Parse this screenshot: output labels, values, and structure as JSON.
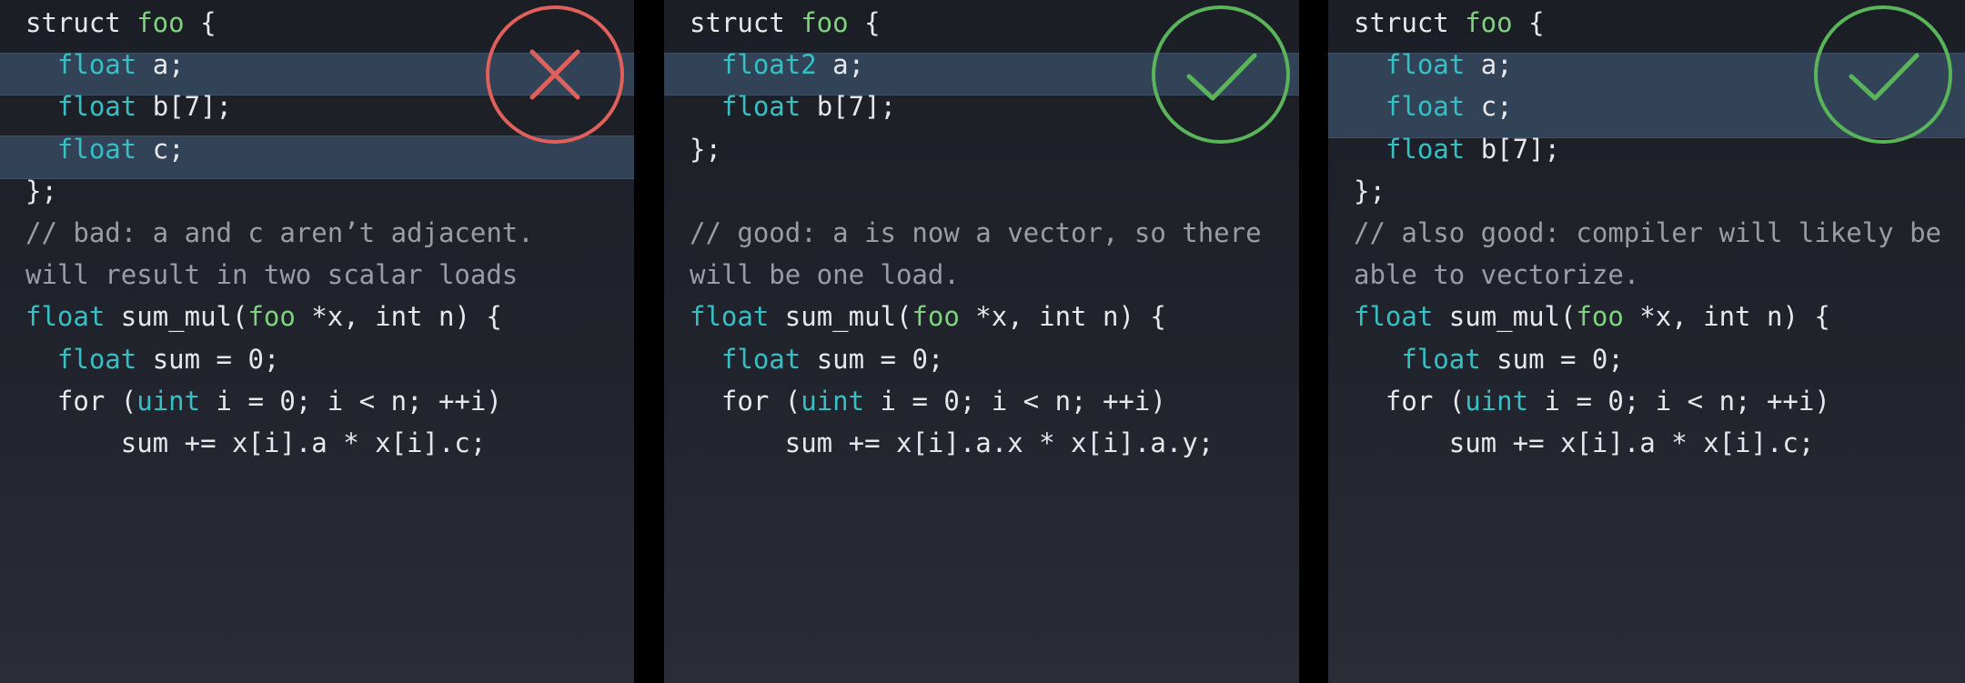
{
  "colors": {
    "background": "#000000",
    "panel_bg": "#22242d",
    "highlight_bg": "#324358",
    "keyword_type": "#34c0c4",
    "struct_name": "#7fd37f",
    "plain_text": "#e8e8ec",
    "comment": "#9a9ca6",
    "bad_mark": "#e0605c",
    "good_mark": "#5ab55a"
  },
  "panels": [
    {
      "verdict": "bad",
      "icon": "cross-circle-icon",
      "lines": [
        {
          "indent": "",
          "tokens": [
            [
              "plain",
              "struct "
            ],
            [
              "name",
              "foo"
            ],
            [
              "plain",
              " {"
            ]
          ]
        },
        {
          "indent": "  ",
          "tokens": [
            [
              "kw",
              "float"
            ],
            [
              "plain",
              " a;"
            ]
          ]
        },
        {
          "indent": "  ",
          "tokens": [
            [
              "kw",
              "float"
            ],
            [
              "plain",
              " b[7];"
            ]
          ]
        },
        {
          "indent": "  ",
          "tokens": [
            [
              "kw",
              "float"
            ],
            [
              "plain",
              " c;"
            ]
          ]
        },
        {
          "indent": "",
          "tokens": [
            [
              "plain",
              "};"
            ]
          ]
        },
        {
          "indent": "",
          "tokens": [
            [
              "comment",
              "// bad: a and c aren’t adjacent."
            ]
          ]
        },
        {
          "indent": "",
          "tokens": [
            [
              "comment",
              "will result in two scalar loads"
            ]
          ]
        },
        {
          "indent": "",
          "tokens": [
            [
              "kw",
              "float"
            ],
            [
              "plain",
              " sum_mul("
            ],
            [
              "name",
              "foo"
            ],
            [
              "plain",
              " *x, int n) {"
            ]
          ]
        },
        {
          "indent": "  ",
          "tokens": [
            [
              "kw",
              "float"
            ],
            [
              "plain",
              " sum = 0;"
            ]
          ]
        },
        {
          "indent": "  ",
          "tokens": [
            [
              "plain",
              "for ("
            ],
            [
              "kw",
              "uint"
            ],
            [
              "plain",
              " i = 0; i < n; ++i)"
            ]
          ]
        },
        {
          "indent": "      ",
          "tokens": [
            [
              "plain",
              "sum += x[i].a * x[i].c;"
            ]
          ]
        }
      ]
    },
    {
      "verdict": "good",
      "icon": "check-circle-icon",
      "lines": [
        {
          "indent": "",
          "tokens": [
            [
              "plain",
              "struct "
            ],
            [
              "name",
              "foo"
            ],
            [
              "plain",
              " {"
            ]
          ]
        },
        {
          "indent": "  ",
          "tokens": [
            [
              "kw",
              "float2"
            ],
            [
              "plain",
              " a;"
            ]
          ]
        },
        {
          "indent": "  ",
          "tokens": [
            [
              "kw",
              "float"
            ],
            [
              "plain",
              " b[7];"
            ]
          ]
        },
        {
          "indent": "",
          "tokens": [
            [
              "plain",
              "};"
            ]
          ]
        },
        {
          "indent": "",
          "tokens": []
        },
        {
          "indent": "",
          "tokens": [
            [
              "comment",
              "// good: a is now a vector, so there"
            ]
          ]
        },
        {
          "indent": "",
          "tokens": [
            [
              "comment",
              "will be one load."
            ]
          ]
        },
        {
          "indent": "",
          "tokens": [
            [
              "kw",
              "float"
            ],
            [
              "plain",
              " sum_mul("
            ],
            [
              "name",
              "foo"
            ],
            [
              "plain",
              " *x, int n) {"
            ]
          ]
        },
        {
          "indent": "  ",
          "tokens": [
            [
              "kw",
              "float"
            ],
            [
              "plain",
              " sum = 0;"
            ]
          ]
        },
        {
          "indent": "  ",
          "tokens": [
            [
              "plain",
              "for ("
            ],
            [
              "kw",
              "uint"
            ],
            [
              "plain",
              " i = 0; i < n; ++i)"
            ]
          ]
        },
        {
          "indent": "      ",
          "tokens": [
            [
              "plain",
              "sum += x[i].a.x * x[i].a.y;"
            ]
          ]
        }
      ]
    },
    {
      "verdict": "good",
      "icon": "check-circle-icon",
      "lines": [
        {
          "indent": "",
          "tokens": [
            [
              "plain",
              "struct "
            ],
            [
              "name",
              "foo"
            ],
            [
              "plain",
              " {"
            ]
          ]
        },
        {
          "indent": "  ",
          "tokens": [
            [
              "kw",
              "float"
            ],
            [
              "plain",
              " a;"
            ]
          ]
        },
        {
          "indent": "  ",
          "tokens": [
            [
              "kw",
              "float"
            ],
            [
              "plain",
              " c;"
            ]
          ]
        },
        {
          "indent": "  ",
          "tokens": [
            [
              "kw",
              "float"
            ],
            [
              "plain",
              " b[7];"
            ]
          ]
        },
        {
          "indent": "",
          "tokens": [
            [
              "plain",
              "};"
            ]
          ]
        },
        {
          "indent": "",
          "tokens": [
            [
              "comment",
              "// also good: compiler will likely be"
            ]
          ]
        },
        {
          "indent": "",
          "tokens": [
            [
              "comment",
              "able to vectorize."
            ]
          ]
        },
        {
          "indent": "",
          "tokens": [
            [
              "kw",
              "float"
            ],
            [
              "plain",
              " sum_mul("
            ],
            [
              "name",
              "foo"
            ],
            [
              "plain",
              " *x, int n) {"
            ]
          ]
        },
        {
          "indent": "   ",
          "tokens": [
            [
              "kw",
              "float"
            ],
            [
              "plain",
              " sum = 0;"
            ]
          ]
        },
        {
          "indent": "  ",
          "tokens": [
            [
              "plain",
              "for ("
            ],
            [
              "kw",
              "uint"
            ],
            [
              "plain",
              " i = 0; i < n; ++i)"
            ]
          ]
        },
        {
          "indent": "      ",
          "tokens": [
            [
              "plain",
              "sum += x[i].a * x[i].c;"
            ]
          ]
        }
      ]
    }
  ]
}
